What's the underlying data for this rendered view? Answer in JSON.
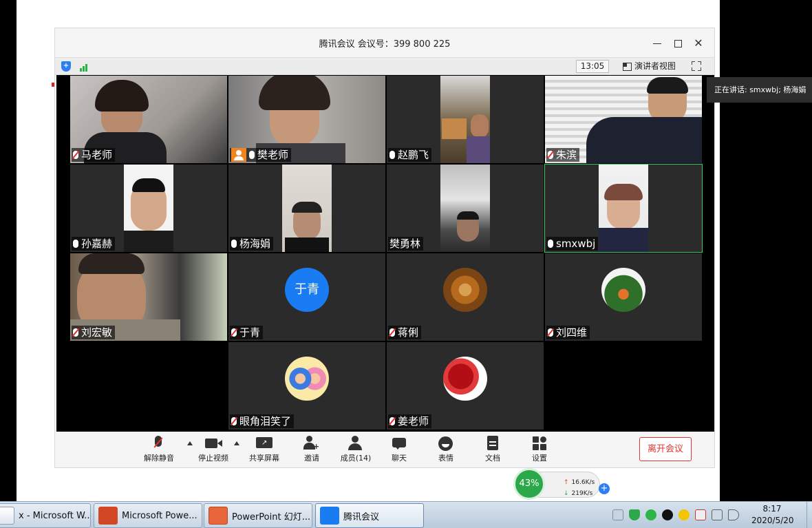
{
  "window": {
    "title": "腾讯会议 会议号：399 800 225",
    "timer": "13:05",
    "speaker_view_label": "演讲者视图"
  },
  "speaking_tooltip": "正在讲话: smxwbj; 杨海娟",
  "participants": [
    {
      "name": "马老师",
      "muted": true,
      "video": true
    },
    {
      "name": "樊老师",
      "muted": false,
      "video": true,
      "host": true
    },
    {
      "name": "赵鹏飞",
      "muted": false,
      "video": true
    },
    {
      "name": "朱滨",
      "muted": true,
      "video": true
    },
    {
      "name": "孙嘉赫",
      "muted": false,
      "video": true
    },
    {
      "name": "杨海娟",
      "muted": false,
      "video": true
    },
    {
      "name": "樊勇林",
      "muted": null,
      "video": true
    },
    {
      "name": "smxwbj",
      "muted": false,
      "video": true,
      "active_speaker": true
    },
    {
      "name": "刘宏敏",
      "muted": true,
      "video": true
    },
    {
      "name": "于青",
      "muted": true,
      "video": false,
      "avatar_text": "于青"
    },
    {
      "name": "蒋俐",
      "muted": true,
      "video": false
    },
    {
      "name": "刘四维",
      "muted": true,
      "video": false
    },
    {
      "name": "眼角泪笑了",
      "muted": true,
      "video": false
    },
    {
      "name": "姜老师",
      "muted": true,
      "video": false
    }
  ],
  "toolbar": {
    "unmute": "解除静音",
    "stop_video": "停止视频",
    "share_screen": "共享屏幕",
    "invite": "邀请",
    "members": "成员(14)",
    "chat": "聊天",
    "reactions": "表情",
    "documents": "文档",
    "settings": "设置",
    "leave": "离开会议"
  },
  "network": {
    "percent": "43%",
    "upload": "16.6K/s",
    "download": "219K/s"
  },
  "taskbar": {
    "tasks": [
      "x - Microsoft W...",
      "Microsoft Powe...",
      "PowerPoint 幻灯...",
      "腾讯会议"
    ],
    "time": "8:17",
    "date": "2020/5/20"
  },
  "colors": {
    "accent": "#1a7cf2",
    "active_border": "#2fcc6b",
    "leave": "#e0342e",
    "network_green": "#2aa84a"
  }
}
